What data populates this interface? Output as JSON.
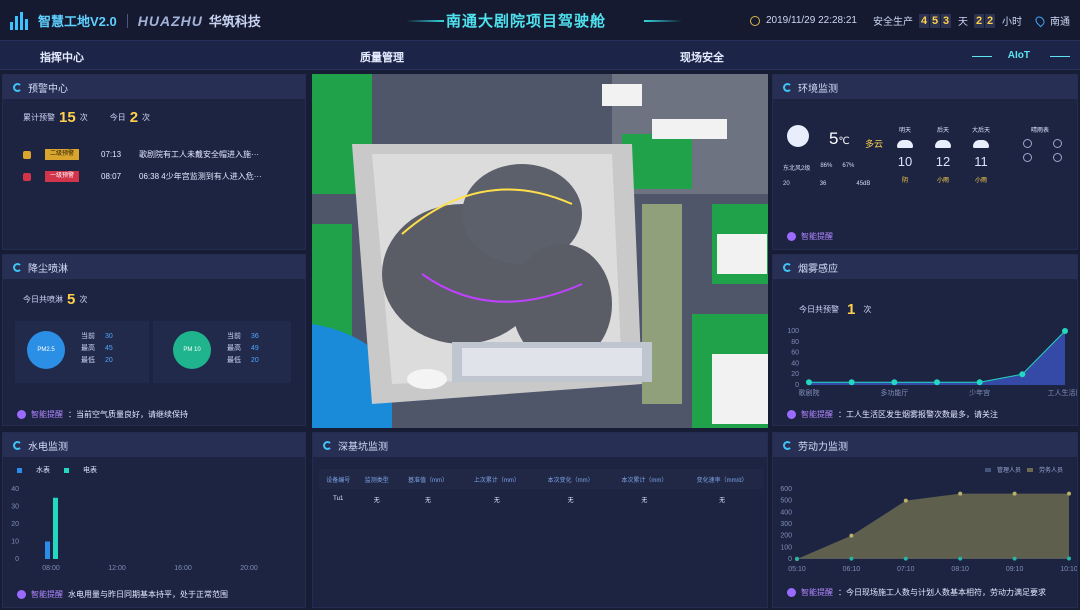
{
  "header": {
    "brand": "智慧工地V2.0",
    "company_en": "HUAZHU",
    "company_cn": "华筑科技",
    "title": "南通大剧院项目驾驶舱",
    "datetime": "2019/11/29 22:28:21",
    "safety_label": "安全生产",
    "safety_days": [
      "4",
      "5",
      "3"
    ],
    "day_unit": "天",
    "safety_hours": [
      "2",
      "2"
    ],
    "hour_unit": "小时",
    "location": "南通"
  },
  "nav": {
    "items": [
      "指挥中心",
      "质量管理",
      "现场安全"
    ],
    "aiot": "AIoT"
  },
  "warning": {
    "title": "预警中心",
    "total_label": "累计预警",
    "total": "15",
    "total_unit": "次",
    "today_label": "今日",
    "today": "2",
    "today_unit": "次",
    "alerts": [
      {
        "level": "二级预警",
        "time": "07:13",
        "text": "歌剧院有工人未戴安全帽进入施···",
        "color": "#d9a52c"
      },
      {
        "level": "一级预警",
        "time": "08:07",
        "text": "06:38 4少年宫监测到有人进入危···",
        "color": "#d2344a"
      }
    ]
  },
  "dust": {
    "title": "降尘喷淋",
    "today_label": "今日共喷淋",
    "count": "5",
    "unit": "次",
    "pm25": {
      "label": "PM2.5",
      "rows": [
        {
          "k": "当前",
          "v": "30"
        },
        {
          "k": "最高",
          "v": "45"
        },
        {
          "k": "最低",
          "v": "20"
        }
      ]
    },
    "pm10": {
      "label": "PM 10",
      "rows": [
        {
          "k": "当前",
          "v": "36"
        },
        {
          "k": "最高",
          "v": "49"
        },
        {
          "k": "最低",
          "v": "20"
        }
      ]
    },
    "smart_label": "智能提醒",
    "smart_text": "：当前空气质量良好，请继续保持"
  },
  "env": {
    "title": "环境监测",
    "temp": "5",
    "temp_unit": "℃",
    "weather": "多云",
    "wind": "东北风2级",
    "humidity": "86%",
    "h2": "67%",
    "v1": "20",
    "v2": "36",
    "noise": "45dB",
    "forecast": [
      {
        "day": "明天",
        "temp": "10",
        "cond": "阴"
      },
      {
        "day": "后天",
        "temp": "12",
        "cond": "小雨"
      },
      {
        "day": "大后天",
        "temp": "11",
        "cond": "小雨"
      }
    ],
    "sun_label": "晴雨表",
    "smart_label": "智能提醒"
  },
  "smoke": {
    "title": "烟雾感应",
    "today_label": "今日共预警",
    "count": "1",
    "unit": "次",
    "smart_label": "智能提醒",
    "smart_text": "：工人生活区发生烟雾报警次数最多，请关注"
  },
  "utility": {
    "title": "水电监测",
    "legend": [
      "水表",
      "电表"
    ],
    "smart_label": "智能提醒",
    "smart_text": "水电用量与昨日同期基本持平，处于正常范围"
  },
  "pit": {
    "title": "深基坑监测",
    "columns": [
      "设备编号",
      "监测类型",
      "基准值（mm）",
      "上次累计（mm）",
      "本次变化（mm）",
      "本次累计（mm）",
      "变化速率（mm/d）"
    ],
    "rows": [
      [
        "Tu1",
        "无",
        "无",
        "无",
        "无",
        "无",
        "无"
      ]
    ]
  },
  "labor": {
    "title": "劳动力监测",
    "legend": [
      "管理人员",
      "劳务人员"
    ],
    "smart_label": "智能提醒",
    "smart_text": "：今日现场施工人数与计划人数基本相符，劳动力满足要求"
  },
  "chart_data": [
    {
      "type": "area",
      "title": "烟雾感应",
      "categories": [
        "歌剧院",
        "",
        "多功能厅",
        "",
        "少年宫",
        "",
        "工人生活区"
      ],
      "series": [
        {
          "values": [
            5,
            5,
            5,
            5,
            5,
            20,
            100
          ]
        }
      ],
      "ylim": [
        0,
        100
      ],
      "yticks": [
        0,
        20,
        40,
        60,
        80,
        100
      ]
    },
    {
      "type": "bar",
      "title": "水电监测",
      "categories": [
        "08:00",
        "12:00",
        "16:00",
        "20:00"
      ],
      "series": [
        {
          "name": "水表",
          "values": [
            10,
            0,
            0,
            0
          ]
        },
        {
          "name": "电表",
          "values": [
            35,
            0,
            0,
            0
          ]
        }
      ],
      "ylim": [
        0,
        40
      ],
      "yticks": [
        0,
        10,
        20,
        30,
        40
      ]
    },
    {
      "type": "area",
      "title": "劳动力监测",
      "categories": [
        "05:10",
        "06:10",
        "07:10",
        "08:10",
        "09:10",
        "10:10"
      ],
      "series": [
        {
          "name": "管理人员",
          "values": [
            2,
            3,
            3,
            3,
            3,
            4
          ]
        },
        {
          "name": "劳务人员",
          "values": [
            0,
            200,
            500,
            560,
            560,
            560
          ]
        }
      ],
      "ylim": [
        0,
        600
      ],
      "yticks": [
        0,
        100,
        200,
        300,
        400,
        500,
        600
      ]
    }
  ]
}
